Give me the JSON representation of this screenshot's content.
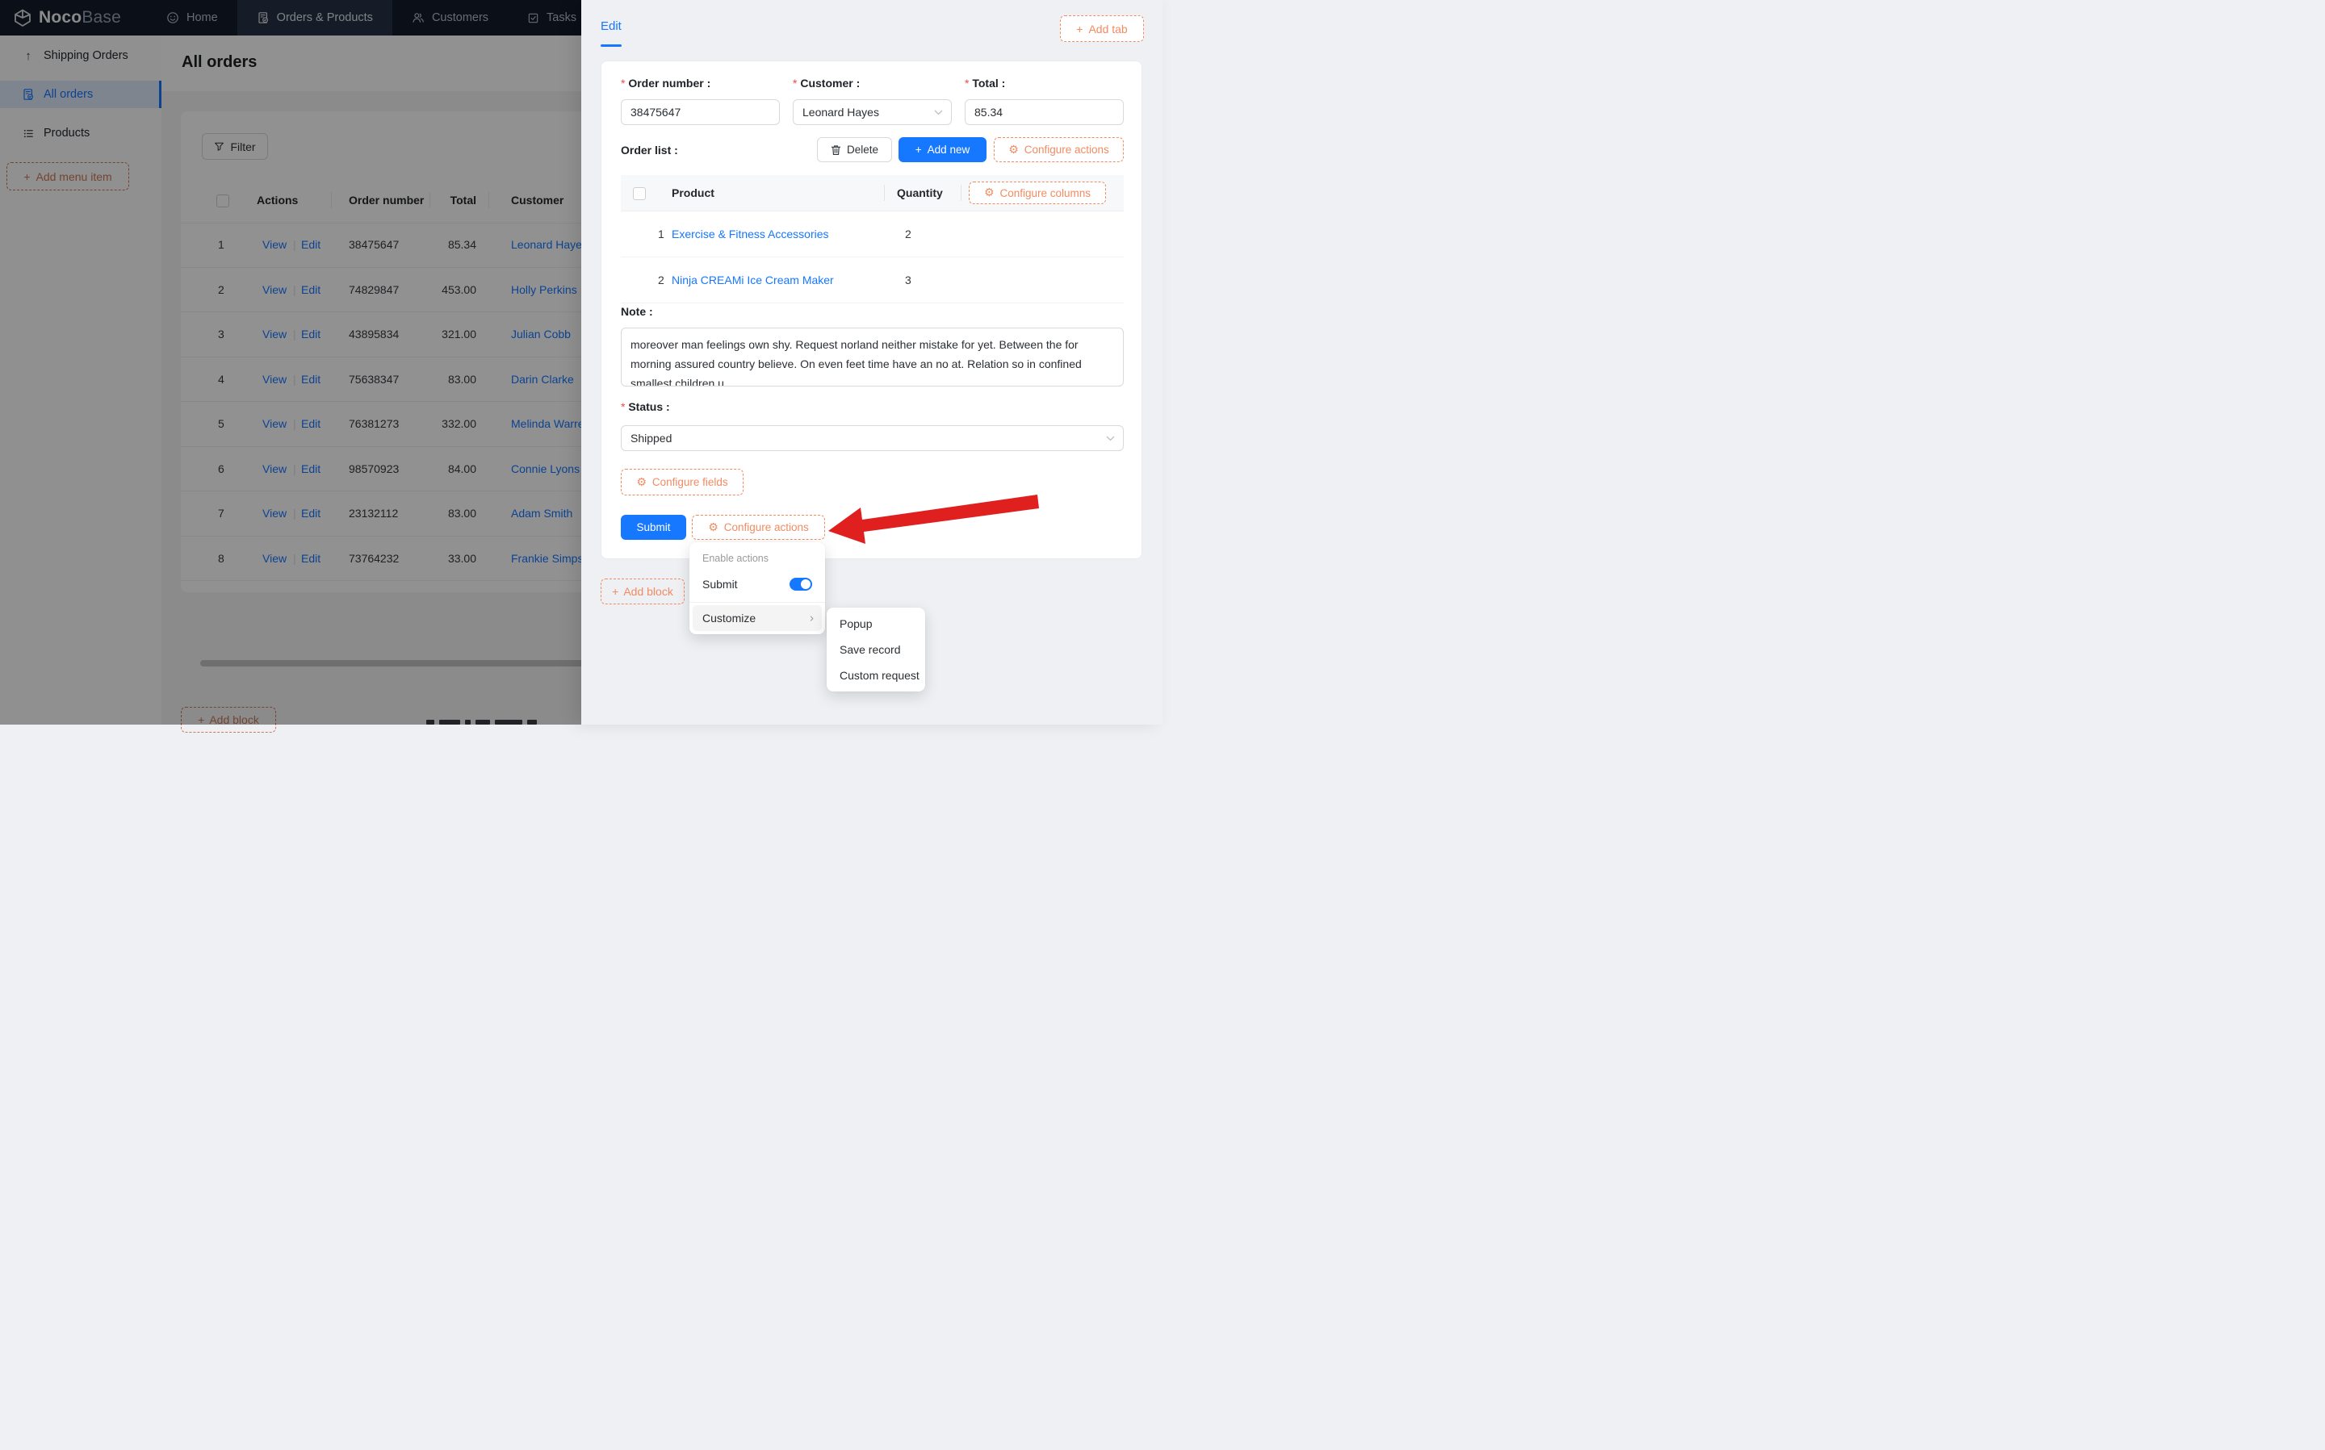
{
  "colors": {
    "primary": "#1677ff",
    "config_orange": "#f18b62",
    "required_red": "#f5464a",
    "arrow_red": "#e01f1f",
    "navbar_bg": "#131c2b"
  },
  "navbar": {
    "brand_bold": "Noco",
    "brand_light": "Base",
    "items": [
      {
        "label": "Home",
        "icon": "smiley-icon",
        "active": false
      },
      {
        "label": "Orders & Products",
        "icon": "order-document-icon",
        "active": true
      },
      {
        "label": "Customers",
        "icon": "users-icon",
        "active": false
      },
      {
        "label": "Tasks",
        "icon": "task-checkbox-icon",
        "active": false
      }
    ]
  },
  "sidebar": {
    "items": [
      {
        "label": "Shipping Orders",
        "icon": "arrow-up-icon",
        "active": false
      },
      {
        "label": "All orders",
        "icon": "order-document-icon",
        "active": true
      },
      {
        "label": "Products",
        "icon": "list-icon",
        "active": false
      }
    ],
    "add_menu_item_label": "Add menu item"
  },
  "main": {
    "title": "All orders",
    "filter_label": "Filter",
    "add_block_label": "Add block",
    "table": {
      "columns": [
        "Actions",
        "Order number",
        "Total",
        "Customer"
      ],
      "action_labels": [
        "View",
        "Edit"
      ],
      "rows": [
        {
          "index": "1",
          "order_number": "38475647",
          "total": "85.34",
          "customer": "Leonard Hayes"
        },
        {
          "index": "2",
          "order_number": "74829847",
          "total": "453.00",
          "customer": "Holly Perkins"
        },
        {
          "index": "3",
          "order_number": "43895834",
          "total": "321.00",
          "customer": "Julian Cobb"
        },
        {
          "index": "4",
          "order_number": "75638347",
          "total": "83.00",
          "customer": "Darin Clarke"
        },
        {
          "index": "5",
          "order_number": "76381273",
          "total": "332.00",
          "customer": "Melinda Warren"
        },
        {
          "index": "6",
          "order_number": "98570923",
          "total": "84.00",
          "customer": "Connie Lyons"
        },
        {
          "index": "7",
          "order_number": "23132112",
          "total": "83.00",
          "customer": "Adam Smith"
        },
        {
          "index": "8",
          "order_number": "73764232",
          "total": "33.00",
          "customer": "Frankie Simpson"
        }
      ]
    }
  },
  "drawer": {
    "tab_label": "Edit",
    "add_tab_label": "Add tab",
    "add_block_label": "Add block",
    "form": {
      "fields": [
        {
          "label": "Order number",
          "required": true,
          "value": "38475647",
          "type": "input"
        },
        {
          "label": "Customer",
          "required": true,
          "value": "Leonard Hayes",
          "type": "select"
        },
        {
          "label": "Total",
          "required": true,
          "value": "85.34",
          "type": "input"
        }
      ],
      "order_list": {
        "label": "Order list",
        "delete_label": "Delete",
        "add_new_label": "Add new",
        "configure_actions_label": "Configure actions",
        "configure_columns_label": "Configure columns",
        "columns": [
          "Product",
          "Quantity"
        ],
        "rows": [
          {
            "index": "1",
            "product": "Exercise & Fitness Accessories",
            "quantity": "2"
          },
          {
            "index": "2",
            "product": "Ninja CREAMi Ice Cream Maker",
            "quantity": "3"
          }
        ]
      },
      "note": {
        "label": "Note",
        "value": "moreover man feelings own shy. Request norland neither mistake for yet. Between the for morning assured country believe. On even feet time have an no at. Relation so in confined smallest children u"
      },
      "status": {
        "label": "Status",
        "required": true,
        "value": "Shipped"
      },
      "configure_fields_label": "Configure fields",
      "submit_label": "Submit",
      "configure_actions_label": "Configure actions"
    },
    "dropdown": {
      "header": "Enable actions",
      "submit_label": "Submit",
      "submit_toggle_on": true,
      "customize_label": "Customize"
    },
    "submenu": {
      "items": [
        "Popup",
        "Save record",
        "Custom request"
      ]
    }
  }
}
